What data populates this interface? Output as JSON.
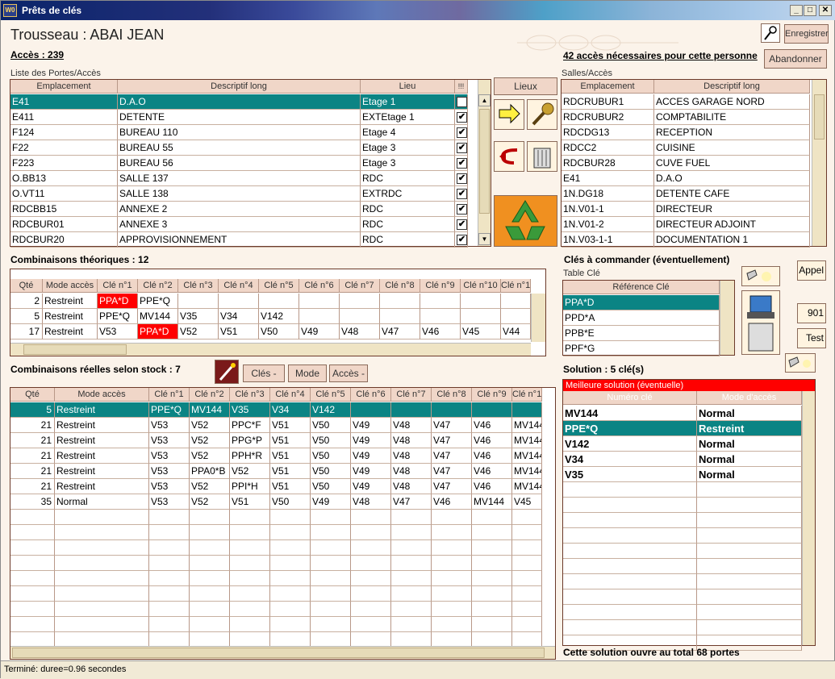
{
  "window": {
    "title": "Prêts de clés",
    "icon": "wd-app-icon"
  },
  "header": {
    "trousseau": "Trousseau : ABAI JEAN",
    "acces_label": "Accès :  239",
    "acces_necessaires": "42 accès nécessaires pour cette personne",
    "btn_enregistrer": "Enregistrer",
    "btn_abandonner": "Abandonner"
  },
  "portes": {
    "caption": "Liste des Portes/Accès",
    "columns": [
      "Emplacement",
      "Descriptif long",
      "Lieu",
      "!!!"
    ],
    "rows": [
      [
        "E41",
        "D.A.O",
        "Etage 1"
      ],
      [
        "E411",
        "DETENTE",
        "EXTEtage 1"
      ],
      [
        "F124",
        "BUREAU 110",
        "Etage 4"
      ],
      [
        "F22",
        "BUREAU 55",
        "Etage 3"
      ],
      [
        "F223",
        "BUREAU 56",
        "Etage 3"
      ],
      [
        "O.BB13",
        "SALLE 137",
        "RDC"
      ],
      [
        "O.VT11",
        "SALLE 138",
        "EXTRDC"
      ],
      [
        "RDCBB15",
        "ANNEXE 2",
        "RDC"
      ],
      [
        "RDCBUR01",
        "ANNEXE 3",
        "RDC"
      ],
      [
        "RDCBUR20",
        "APPROVISIONNEMENT",
        "RDC"
      ]
    ]
  },
  "lieux_button": "Lieux",
  "salles": {
    "caption": "Salles/Accès",
    "columns": [
      "Emplacement",
      "Descriptif long"
    ],
    "rows": [
      [
        "RDCRUBUR1",
        "ACCES GARAGE NORD"
      ],
      [
        "RDCRUBUR2",
        "COMPTABILITE"
      ],
      [
        "RDCDG13",
        "RECEPTION"
      ],
      [
        "RDCC2",
        "CUISINE"
      ],
      [
        "RDCBUR28",
        "CUVE FUEL"
      ],
      [
        "E41",
        "D.A.O"
      ],
      [
        "1N.DG18",
        "DETENTE CAFE"
      ],
      [
        "1N.V01-1",
        "DIRECTEUR"
      ],
      [
        "1N.V01-2",
        "DIRECTEUR ADJOINT"
      ],
      [
        "1N.V03-1-1",
        "DOCUMENTATION 1"
      ]
    ]
  },
  "theo": {
    "title": "Combinaisons théoriques :  12",
    "columns": [
      "Qté",
      "Mode accès",
      "Clé n°1",
      "Clé n°2",
      "Clé n°3",
      "Clé n°4",
      "Clé n°5",
      "Clé n°6",
      "Clé n°7",
      "Clé n°8",
      "Clé n°9",
      "Clé n°10",
      "Clé n°1"
    ],
    "rows": [
      [
        "2",
        "Restreint",
        "PPA*D",
        "PPE*Q",
        "",
        "",
        "",
        "",
        "",
        "",
        "",
        "",
        ""
      ],
      [
        "5",
        "Restreint",
        "PPE*Q",
        "MV144",
        "V35",
        "V34",
        "V142",
        "",
        "",
        "",
        "",
        "",
        ""
      ],
      [
        "17",
        "Restreint",
        "V53",
        "PPA*D",
        "V52",
        "V51",
        "V50",
        "V49",
        "V48",
        "V47",
        "V46",
        "V45",
        "V44"
      ]
    ]
  },
  "commande": {
    "title": "Clés à commander (éventuellement)",
    "caption": "Table Clé",
    "column": "Référence Clé",
    "rows": [
      "PPA*D",
      "PPD*A",
      "PPB*E",
      "PPF*G"
    ],
    "btn_appel": "Appel",
    "btn_901": "901",
    "btn_test": "Test"
  },
  "reelles": {
    "title": "Combinaisons réelles selon stock :  7",
    "btn_cles": "Clés -",
    "btn_mode": "Mode",
    "btn_acces": "Accès -",
    "columns": [
      "Qté",
      "Mode accès",
      "Clé n°1",
      "Clé n°2",
      "Clé n°3",
      "Clé n°4",
      "Clé n°5",
      "Clé n°6",
      "Clé n°7",
      "Clé n°8",
      "Clé n°9",
      "Clé n°1"
    ],
    "rows": [
      [
        "5",
        "Restreint",
        "PPE*Q",
        "MV144",
        "V35",
        "V34",
        "V142",
        "",
        "",
        "",
        "",
        ""
      ],
      [
        "21",
        "Restreint",
        "V53",
        "V52",
        "PPC*F",
        "V51",
        "V50",
        "V49",
        "V48",
        "V47",
        "V46",
        "MV144"
      ],
      [
        "21",
        "Restreint",
        "V53",
        "V52",
        "PPG*P",
        "V51",
        "V50",
        "V49",
        "V48",
        "V47",
        "V46",
        "MV144"
      ],
      [
        "21",
        "Restreint",
        "V53",
        "V52",
        "PPH*R",
        "V51",
        "V50",
        "V49",
        "V48",
        "V47",
        "V46",
        "MV144"
      ],
      [
        "21",
        "Restreint",
        "V53",
        "PPA0*B",
        "V52",
        "V51",
        "V50",
        "V49",
        "V48",
        "V47",
        "V46",
        "MV144"
      ],
      [
        "21",
        "Restreint",
        "V53",
        "V52",
        "PPI*H",
        "V51",
        "V50",
        "V49",
        "V48",
        "V47",
        "V46",
        "MV144"
      ],
      [
        "35",
        "Normal",
        "V53",
        "V52",
        "V51",
        "V50",
        "V49",
        "V48",
        "V47",
        "V46",
        "MV144",
        "V45"
      ]
    ]
  },
  "solution": {
    "title": "Solution :  5  clé(s)",
    "banner": "Meilleure solution (éventuelle)",
    "columns": [
      "Numéro clé",
      "Mode d'accès"
    ],
    "rows": [
      [
        "MV144",
        "Normal"
      ],
      [
        "PPE*Q",
        "Restreint"
      ],
      [
        "V142",
        "Normal"
      ],
      [
        "V34",
        "Normal"
      ],
      [
        "V35",
        "Normal"
      ]
    ],
    "footer": "Cette solution ouvre au total 68 portes"
  },
  "status": "Terminé: duree=0.96 secondes"
}
